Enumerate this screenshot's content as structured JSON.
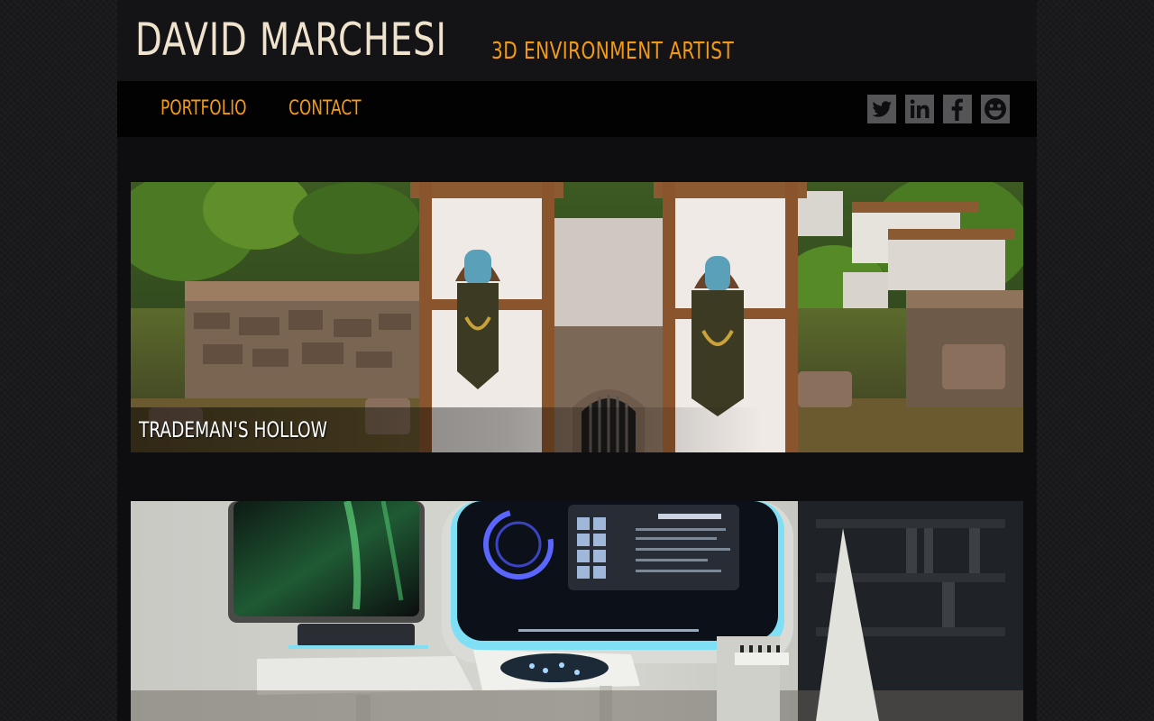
{
  "header": {
    "site_name": "DAVID MARCHESI",
    "tagline": "3D ENVIRONMENT ARTIST"
  },
  "nav": {
    "items": [
      {
        "label": "PORTFOLIO"
      },
      {
        "label": "CONTACT"
      }
    ]
  },
  "social": [
    {
      "icon": "twitter-icon"
    },
    {
      "icon": "linkedin-icon"
    },
    {
      "icon": "facebook-icon"
    },
    {
      "icon": "smiley-icon"
    }
  ],
  "projects": [
    {
      "title": "TRADEMAN'S HOLLOW"
    },
    {
      "title": ""
    }
  ],
  "colors": {
    "accent": "#f39a14",
    "site_name": "#efe3cd",
    "nav_background": "#020202",
    "page_background": "#0e0e10",
    "social_icon_bg": "#555558"
  }
}
